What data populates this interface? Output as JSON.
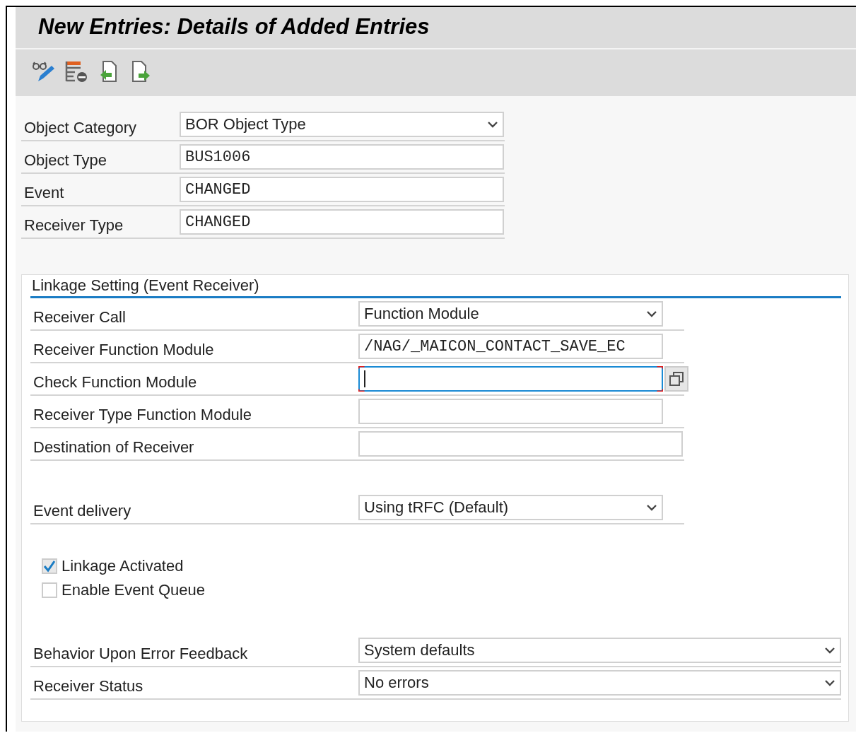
{
  "title": "New Entries: Details of Added Entries",
  "header_fields": [
    {
      "label": "Object Category",
      "kind": "dropdown",
      "value": "BOR Object Type"
    },
    {
      "label": "Object Type",
      "kind": "text",
      "value": "BUS1006"
    },
    {
      "label": "Event",
      "kind": "text",
      "value": "CHANGED"
    },
    {
      "label": "Receiver Type",
      "kind": "text",
      "value": "CHANGED"
    }
  ],
  "linkage": {
    "title": "Linkage Setting (Event Receiver)",
    "fields": [
      {
        "label": "Receiver Call",
        "kind": "dropdown",
        "value": "Function Module"
      },
      {
        "label": "Receiver Function Module",
        "kind": "text",
        "value": "/NAG/_MAICON_CONTACT_SAVE_EC"
      },
      {
        "label": "Check Function Module",
        "kind": "focused"
      },
      {
        "label": "Receiver Type Function Module",
        "kind": "empty"
      },
      {
        "label": "Destination of Receiver",
        "kind": "empty"
      }
    ],
    "delivery": {
      "label": "Event delivery",
      "kind": "dropdown",
      "value": "Using tRFC (Default)"
    },
    "checkboxes": [
      {
        "label": "Linkage Activated",
        "checked": true
      },
      {
        "label": "Enable Event Queue",
        "checked": false
      }
    ],
    "error_fields": [
      {
        "label": "Behavior Upon Error Feedback",
        "kind": "dropdown",
        "value": "System defaults"
      },
      {
        "label": "Receiver Status",
        "kind": "dropdown",
        "value": "No errors"
      }
    ]
  }
}
